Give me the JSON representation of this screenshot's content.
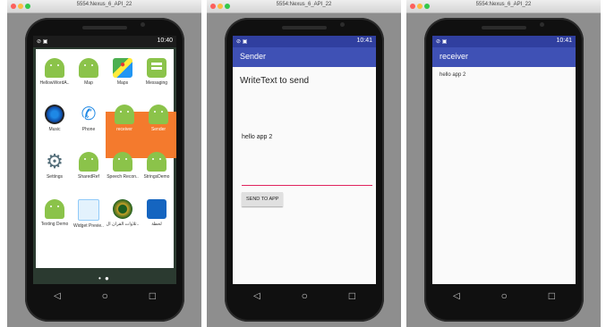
{
  "windows": [
    {
      "title": "5554:Nexus_6_API_22",
      "status_time": "10:40",
      "status_icons": "⊘ ▣",
      "apps": [
        {
          "label": "HellowWordA..",
          "icon": "android-icon"
        },
        {
          "label": "Map",
          "icon": "android-icon"
        },
        {
          "label": "Maps",
          "icon": "maps-icon"
        },
        {
          "label": "Messaging",
          "icon": "messaging-icon"
        },
        {
          "label": "Music",
          "icon": "music-icon"
        },
        {
          "label": "Phone",
          "icon": "phone-icon"
        },
        {
          "label": "receiver",
          "icon": "android-icon"
        },
        {
          "label": "Sender",
          "icon": "android-icon"
        },
        {
          "label": "Settings",
          "icon": "settings-icon"
        },
        {
          "label": "SharedRef",
          "icon": "android-icon"
        },
        {
          "label": "Speech Recon..",
          "icon": "android-icon"
        },
        {
          "label": "StringsDemo",
          "icon": "android-icon"
        },
        {
          "label": "Texting Demo",
          "icon": "android-icon"
        },
        {
          "label": "Widget Previe..",
          "icon": "widget-icon"
        },
        {
          "label": "تلاوات القرآن ال..",
          "icon": "quran-icon"
        },
        {
          "label": "لحظة",
          "icon": "lahza-icon"
        }
      ],
      "page_dots": "• ●"
    },
    {
      "title": "5554:Nexus_6_API_22",
      "status_time": "10:41",
      "status_icons": "⊘ ▣",
      "app_title": "Sender",
      "heading": "WriteText to send",
      "message": "hello app 2",
      "button_label": "SEND TO APP"
    },
    {
      "title": "5554:Nexus_6_API_22",
      "status_time": "10:41",
      "status_icons": "⊘ ▣",
      "app_title": "receiver",
      "received_text": "hello app 2"
    }
  ],
  "nav": {
    "back": "◁",
    "home": "○",
    "recents": "□"
  },
  "colors": {
    "primary": "#3f51b5",
    "primary_dark": "#303f9f",
    "accent": "#e0245e",
    "highlight": "#f47a2d",
    "android_green": "#8bc34a"
  }
}
